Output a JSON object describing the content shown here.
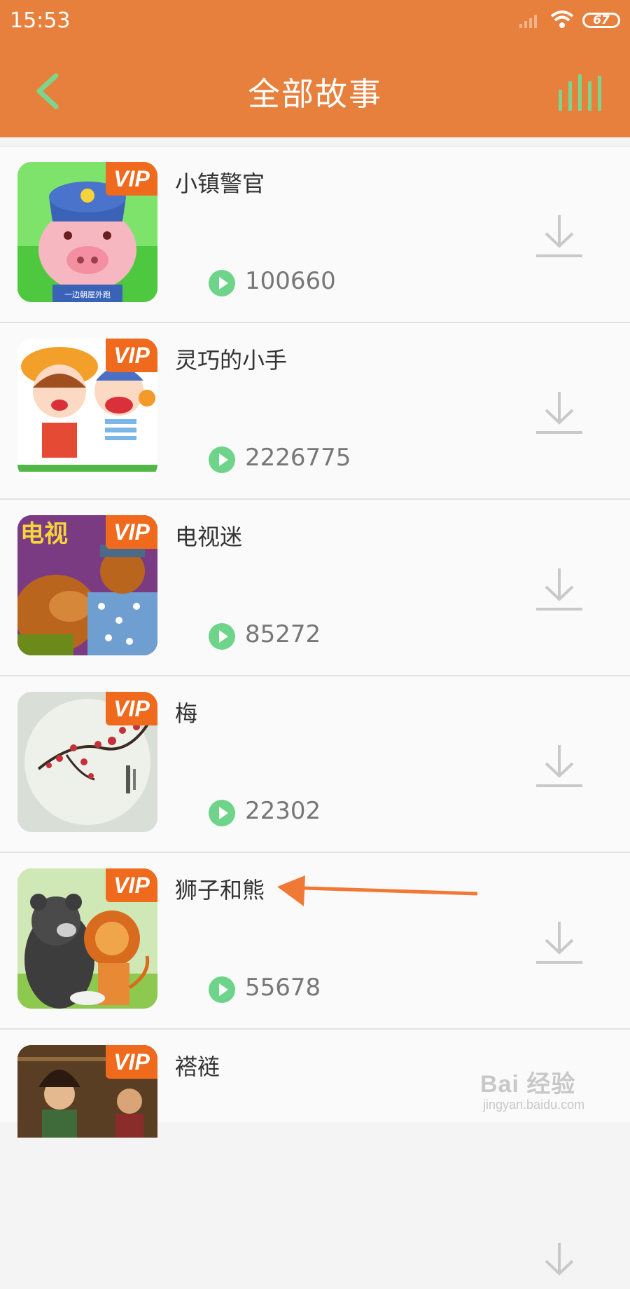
{
  "status_bar": {
    "time": "15:53",
    "battery": "67"
  },
  "header": {
    "title": "全部故事"
  },
  "colors": {
    "header_bg": "#e8803d",
    "vip_bg": "#ef6a1c",
    "play_green": "#6dd489",
    "back_green": "#7dd48c"
  },
  "items": [
    {
      "name": "小镇警官",
      "count": "100660",
      "badge": "VIP",
      "thumb_caption": "一边朝屋外跑"
    },
    {
      "name": "灵巧的小手",
      "count": "2226775",
      "badge": "VIP"
    },
    {
      "name": "电视迷",
      "count": "85272",
      "badge": "VIP",
      "thumb_caption": "电视"
    },
    {
      "name": "梅",
      "count": "22302",
      "badge": "VIP"
    },
    {
      "name": "狮子和熊",
      "count": "55678",
      "badge": "VIP"
    },
    {
      "name": "褡裢",
      "count": "",
      "badge": "VIP"
    }
  ],
  "watermark": {
    "main": "Bai 经验",
    "sub": "jingyan.baidu.com"
  }
}
